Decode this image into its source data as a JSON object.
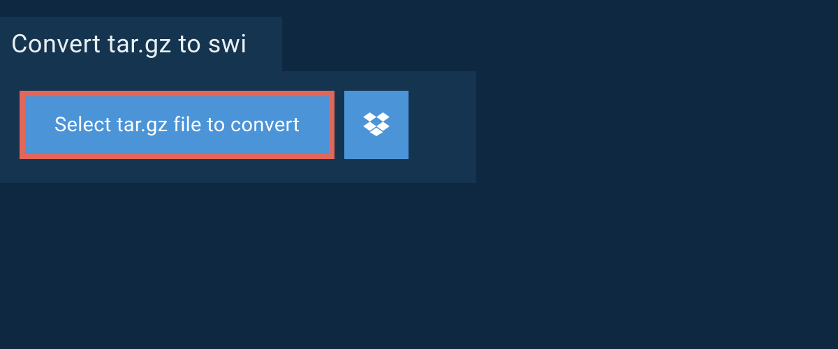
{
  "header": {
    "title": "Convert tar.gz to swi"
  },
  "actions": {
    "select_label": "Select tar.gz file to convert"
  },
  "colors": {
    "page_bg": "#0d2840",
    "panel_bg": "#14344f",
    "button_bg": "#4b94d8",
    "highlight_border": "#e1675b",
    "text_light": "#ffffff"
  }
}
